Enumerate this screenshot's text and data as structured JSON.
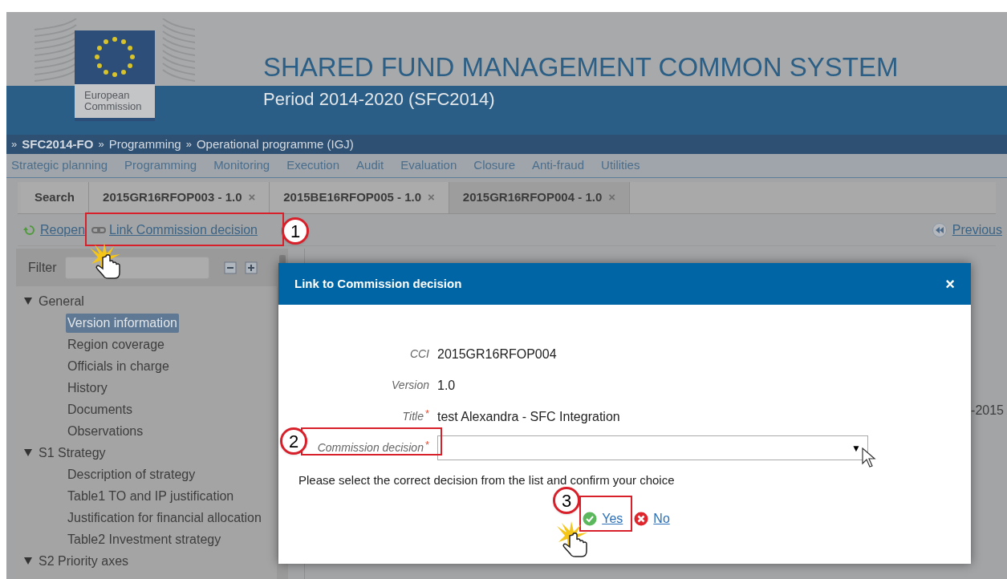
{
  "header": {
    "logo_text": "European Commission",
    "title": "SHARED FUND MANAGEMENT COMMON SYSTEM",
    "subtitle": "Period 2014-2020 (SFC2014)"
  },
  "breadcrumb": {
    "separator": "»",
    "items": [
      {
        "label": "SFC2014-FO",
        "bold": true
      },
      {
        "label": "Programming",
        "bold": false
      },
      {
        "label": "Operational programme (IGJ)",
        "bold": false
      }
    ]
  },
  "menu": [
    "Strategic planning",
    "Programming",
    "Monitoring",
    "Execution",
    "Audit",
    "Evaluation",
    "Closure",
    "Anti-fraud",
    "Utilities"
  ],
  "tabs": [
    {
      "label": "Search",
      "closable": false,
      "selected": false
    },
    {
      "label": "2015GR16RFOP003 - 1.0",
      "closable": true,
      "selected": false
    },
    {
      "label": "2015BE16RFOP005 - 1.0",
      "closable": true,
      "selected": false
    },
    {
      "label": "2015GR16RFOP004 - 1.0",
      "closable": true,
      "selected": true
    }
  ],
  "tab_close": "×",
  "toolbar": {
    "actions": [
      {
        "label": "Reopen",
        "kind": "reopen"
      },
      {
        "label": "Link Commission decision",
        "kind": "link"
      }
    ],
    "previous": "Previous"
  },
  "sidebar": {
    "filter_label": "Filter",
    "tree": [
      {
        "label": "General",
        "expanded": true,
        "children": [
          {
            "label": "Version information",
            "selected": true
          },
          {
            "label": "Region coverage",
            "selected": false
          },
          {
            "label": "Officials in charge",
            "selected": false
          },
          {
            "label": "History",
            "selected": false
          },
          {
            "label": "Documents",
            "selected": false
          },
          {
            "label": "Observations",
            "selected": false
          }
        ]
      },
      {
        "label": "S1 Strategy",
        "expanded": true,
        "children": [
          {
            "label": "Description of strategy",
            "selected": false
          },
          {
            "label": "Table1 TO and IP justification",
            "selected": false
          },
          {
            "label": "Justification for financial allocation",
            "selected": false
          },
          {
            "label": "Table2 Investment strategy",
            "selected": false
          }
        ]
      },
      {
        "label": "S2 Priority axes",
        "expanded": true
      }
    ]
  },
  "content": {
    "partial_text": "-2015"
  },
  "dialog": {
    "title": "Link to Commission decision",
    "close": "×",
    "fields": [
      {
        "label": "CCI",
        "value": "2015GR16RFOP004",
        "required": false,
        "kind": "text"
      },
      {
        "label": "Version",
        "value": "1.0",
        "required": false,
        "kind": "text"
      },
      {
        "label": "Title",
        "value": "test Alexandra - SFC Integration",
        "required": true,
        "kind": "text"
      },
      {
        "label": "Commission decision",
        "required": true,
        "kind": "select"
      }
    ],
    "required_mark": "*",
    "select_arrow": "▼",
    "hint": "Please select the correct decision from the list and confirm your choice",
    "yes": "Yes",
    "no": "No"
  },
  "callouts": [
    "1",
    "2",
    "3"
  ]
}
